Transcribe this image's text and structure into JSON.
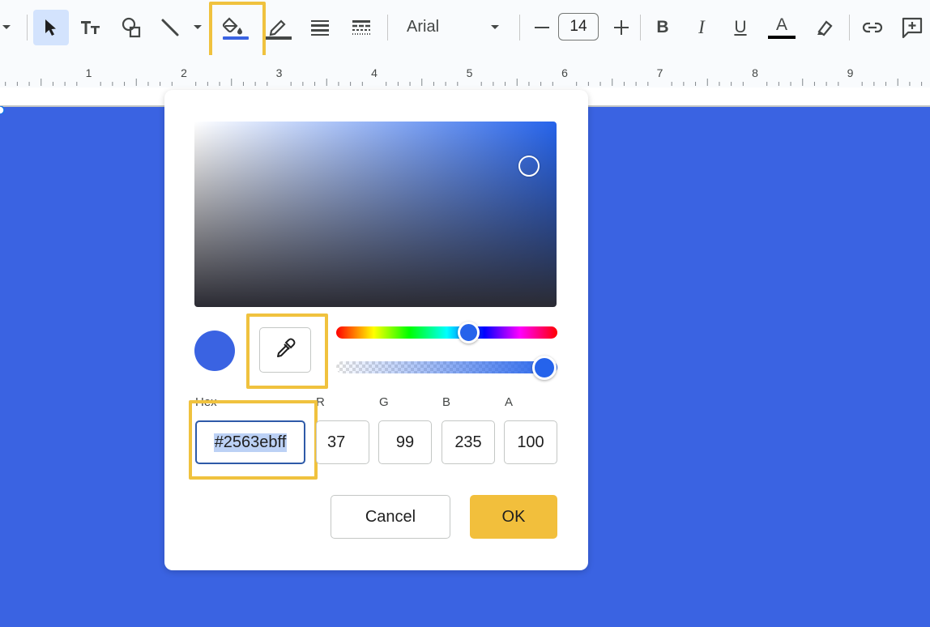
{
  "toolbar": {
    "font_name": "Arial",
    "font_size": "14",
    "icons": [
      "dropdown-arrow-icon",
      "select-cursor-icon",
      "text-box-icon",
      "shape-icon",
      "line-icon",
      "dropdown-arrow-icon",
      "fill-color-icon",
      "border-color-icon",
      "border-weight-icon",
      "border-dash-icon",
      "font-dropdown-arrow-icon",
      "decrease-font-size-icon",
      "increase-font-size-icon",
      "bold-icon",
      "italic-icon",
      "underline-icon",
      "text-color-icon",
      "highlight-icon",
      "link-icon",
      "comment-icon"
    ],
    "fill_color_underline": "#3a63e2",
    "bold_label": "B",
    "italic_label": "I",
    "underline_label": "U",
    "text_color_label": "A"
  },
  "ruler": {
    "numbers": [
      "1",
      "2",
      "3",
      "4",
      "5",
      "6",
      "7",
      "8",
      "9"
    ]
  },
  "color_picker": {
    "current_color": "#2563eb",
    "hue_color": "#2563eb",
    "fields": {
      "hex_label": "Hex",
      "hex_value": "#2563ebff",
      "r_label": "R",
      "r_value": "37",
      "g_label": "G",
      "g_value": "99",
      "b_label": "B",
      "b_value": "235",
      "a_label": "A",
      "a_value": "100"
    },
    "cancel_label": "Cancel",
    "ok_label": "OK"
  },
  "colors": {
    "canvas_background": "#3a63e2",
    "highlight_box": "#f0c23e",
    "ok_button": "#f2bf3c"
  }
}
